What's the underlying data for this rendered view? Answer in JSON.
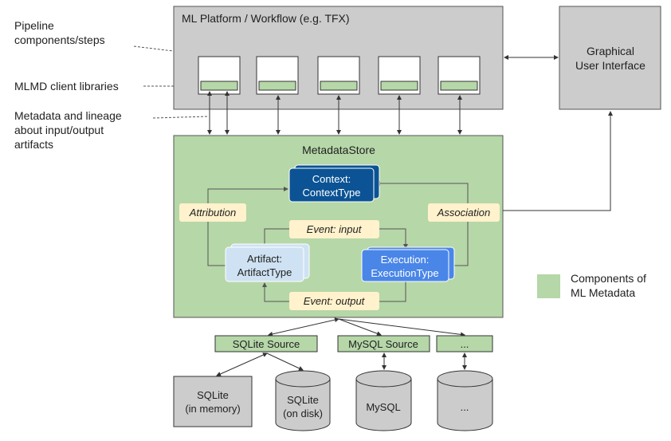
{
  "colors": {
    "platform_fill": "#cccccc",
    "store_fill": "#b6d7a8",
    "component_green": "#b6d7a8",
    "relation_label_fill": "#fff2cc",
    "context_fill": "#0b5394",
    "artifact_fill": "#cfe2f3",
    "execution_fill": "#4a86e8",
    "storage_fill": "#cccccc"
  },
  "annotations": {
    "pipeline_line1": "Pipeline",
    "pipeline_line2": "components/steps",
    "client_libs": "MLMD client libraries",
    "metadata_line1": "Metadata and lineage",
    "metadata_line2": "about input/output",
    "metadata_line3": "artifacts"
  },
  "platform": {
    "title": "ML Platform / Workflow (e.g. TFX)"
  },
  "gui": {
    "line1": "Graphical",
    "line2": "User Interface"
  },
  "store": {
    "title": "MetadataStore",
    "context": {
      "line1": "Context:",
      "line2": "ContextType"
    },
    "artifact": {
      "line1": "Artifact:",
      "line2": "ArtifactType"
    },
    "execution": {
      "line1": "Execution:",
      "line2": "ExecutionType"
    },
    "attribution": "Attribution",
    "association": "Association",
    "event_input": "Event: input",
    "event_output": "Event: output"
  },
  "sources": [
    "SQLite Source",
    "MySQL Source",
    "..."
  ],
  "storage": {
    "sqlite_memory_line1": "SQLite",
    "sqlite_memory_line2": "(in memory)",
    "sqlite_disk_line1": "SQLite",
    "sqlite_disk_line2": "(on disk)",
    "mysql": "MySQL",
    "other": "..."
  },
  "legend": {
    "line1": "Components of",
    "line2": "ML Metadata"
  }
}
